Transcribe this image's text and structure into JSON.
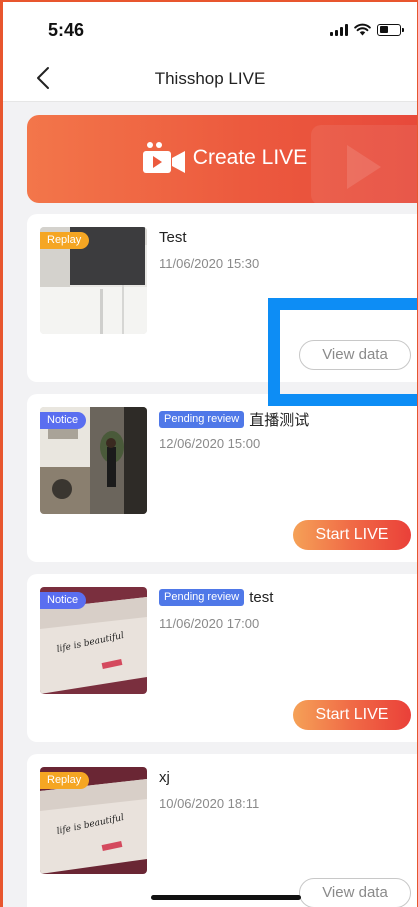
{
  "status": {
    "time": "5:46"
  },
  "nav": {
    "title": "Thisshop LIVE",
    "back_icon": "chevron-left-icon"
  },
  "banner": {
    "label": "Create LIVE",
    "icon": "video-camera-icon"
  },
  "cards": [
    {
      "tag": "Replay",
      "title": "Test",
      "pending": "",
      "date": "11/06/2020 15:30",
      "button": "View data"
    },
    {
      "tag": "Notice",
      "title": "直播测试",
      "pending": "Pending review",
      "date": "12/06/2020 15:00",
      "button": "Start LIVE"
    },
    {
      "tag": "Notice",
      "title": "test",
      "pending": "Pending review",
      "date": "11/06/2020 17:00",
      "button": "Start LIVE"
    },
    {
      "tag": "Replay",
      "title": "xj",
      "pending": "",
      "date": "10/06/2020 18:11",
      "button": "View data"
    }
  ],
  "thumbnail_captions": {
    "paper_text": "life is beautiful"
  },
  "colors": {
    "accent": "#ec5a3e",
    "replay_tag": "#f5a623",
    "notice_tag": "#5a6ef0",
    "pending_badge": "#4f78e8",
    "highlight": "#0d8df5"
  }
}
